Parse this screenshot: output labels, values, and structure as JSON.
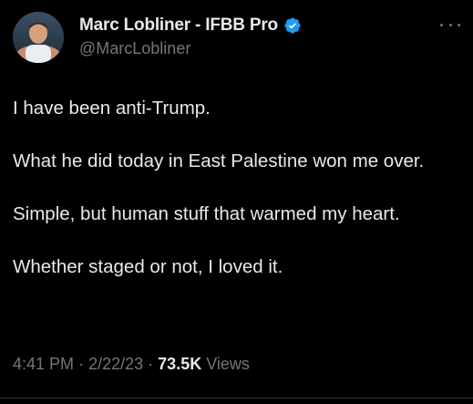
{
  "author": {
    "display_name": "Marc Lobliner - IFBB Pro",
    "handle": "@MarcLobliner",
    "avatar_icon": "profile-photo",
    "verified_icon": "verified-badge-icon",
    "verified_color": "#1d9bf0"
  },
  "tweet": {
    "paragraphs": [
      "I have been anti-Trump.",
      "What he did today in East Palestine won me over.",
      "Simple, but human stuff that warmed my heart.",
      "Whether staged or not, I loved it."
    ],
    "time": "4:41 PM",
    "separator": "·",
    "date": "2/22/23",
    "views_count": "73.5K",
    "views_label": "Views"
  },
  "menu": {
    "icon": "more-options-icon"
  },
  "colors": {
    "background": "#000000",
    "text_primary": "#e7e9ea",
    "text_secondary": "#71767b"
  }
}
